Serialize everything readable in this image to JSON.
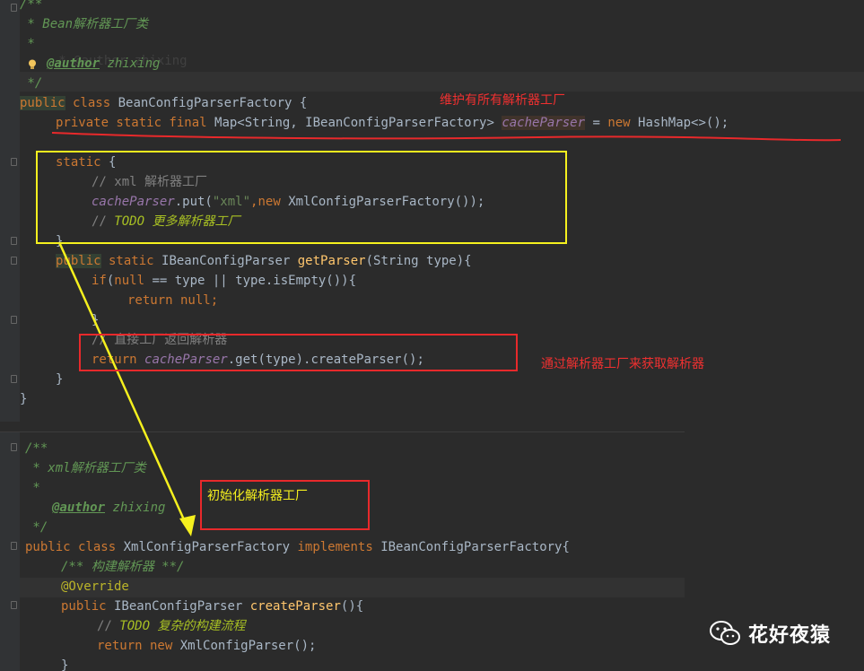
{
  "top_code": {
    "doc_open": "/**",
    "doc_title": " * Bean解析器工厂类",
    "doc_blank": " *",
    "author_tag": "@author",
    "author_name": " zhixing",
    "doc_close": " */",
    "class_kw": "public",
    "class_kw2": " class ",
    "class_name": "BeanConfigParserFactory {",
    "field_mods": "private static final ",
    "field_type": "Map<String, IBeanConfigParserFactory> ",
    "field_name": "cacheParser",
    "field_rest": " = ",
    "field_new": "new",
    "field_init": " HashMap<>();",
    "static_kw": "static",
    "static_brace": " {",
    "comment_xml": "// xml 解析器工厂",
    "put_field": "cacheParser",
    "put_call": ".put(",
    "put_str": "\"xml\"",
    "put_comma": ",",
    "put_new": "new",
    "put_rest": " XmlConfigParserFactory());",
    "todo_prefix": "// ",
    "todo_word": "TODO",
    "todo_text": " 更多解析器工厂",
    "close_brace": "}",
    "getter_public": "public",
    "getter_static": " static ",
    "getter_type": "IBeanConfigParser ",
    "getter_name": "getParser",
    "getter_args": "(String type){",
    "if_kw": "if",
    "if_open": "(",
    "if_null": "null",
    "if_rest": " == type || type.isEmpty()){",
    "return_kw": "return",
    "return_null": " null;",
    "inner_close": "}",
    "comment_direct": "// 直接工厂返回解析器",
    "return2_kw": "return ",
    "return2_field": "cacheParser",
    "return2_rest": ".get(type).createParser();",
    "method_close": "}",
    "class_close": "}"
  },
  "bottom_code": {
    "doc_open": "/**",
    "doc_title": " * xml解析器工厂类",
    "doc_blank": " *",
    "author_tag": "@author",
    "author_name": " zhixing",
    "doc_close": " */",
    "decl_public": "public",
    "decl_class": " class ",
    "decl_name": "XmlConfigParserFactory ",
    "decl_impl": "implements",
    "decl_rest": " IBeanConfigParserFactory{",
    "comment_build": "/** 构建解析器 **/",
    "override": "@Override",
    "create_public": "public",
    "create_type": " IBeanConfigParser ",
    "create_name": "createParser",
    "create_rest": "(){",
    "todo_prefix": "// ",
    "todo_word": "TODO",
    "todo_text": " 复杂的构建流程",
    "return_kw": "return new",
    "return_rest": " XmlConfigParser();",
    "close": "}"
  },
  "annotations": {
    "note_factory_cache": "维护有所有解析器工厂",
    "note_get_parser": "通过解析器工厂来获取解析器",
    "note_init": "初始化解析器工厂",
    "colors": {
      "red": "#e8292b",
      "yellow": "#f5f01e",
      "red_text": "#f03030",
      "yellow_text": "#f5f01e"
    }
  },
  "watermark": {
    "brand": "花好夜猿",
    "icon": "wechat-icon"
  }
}
